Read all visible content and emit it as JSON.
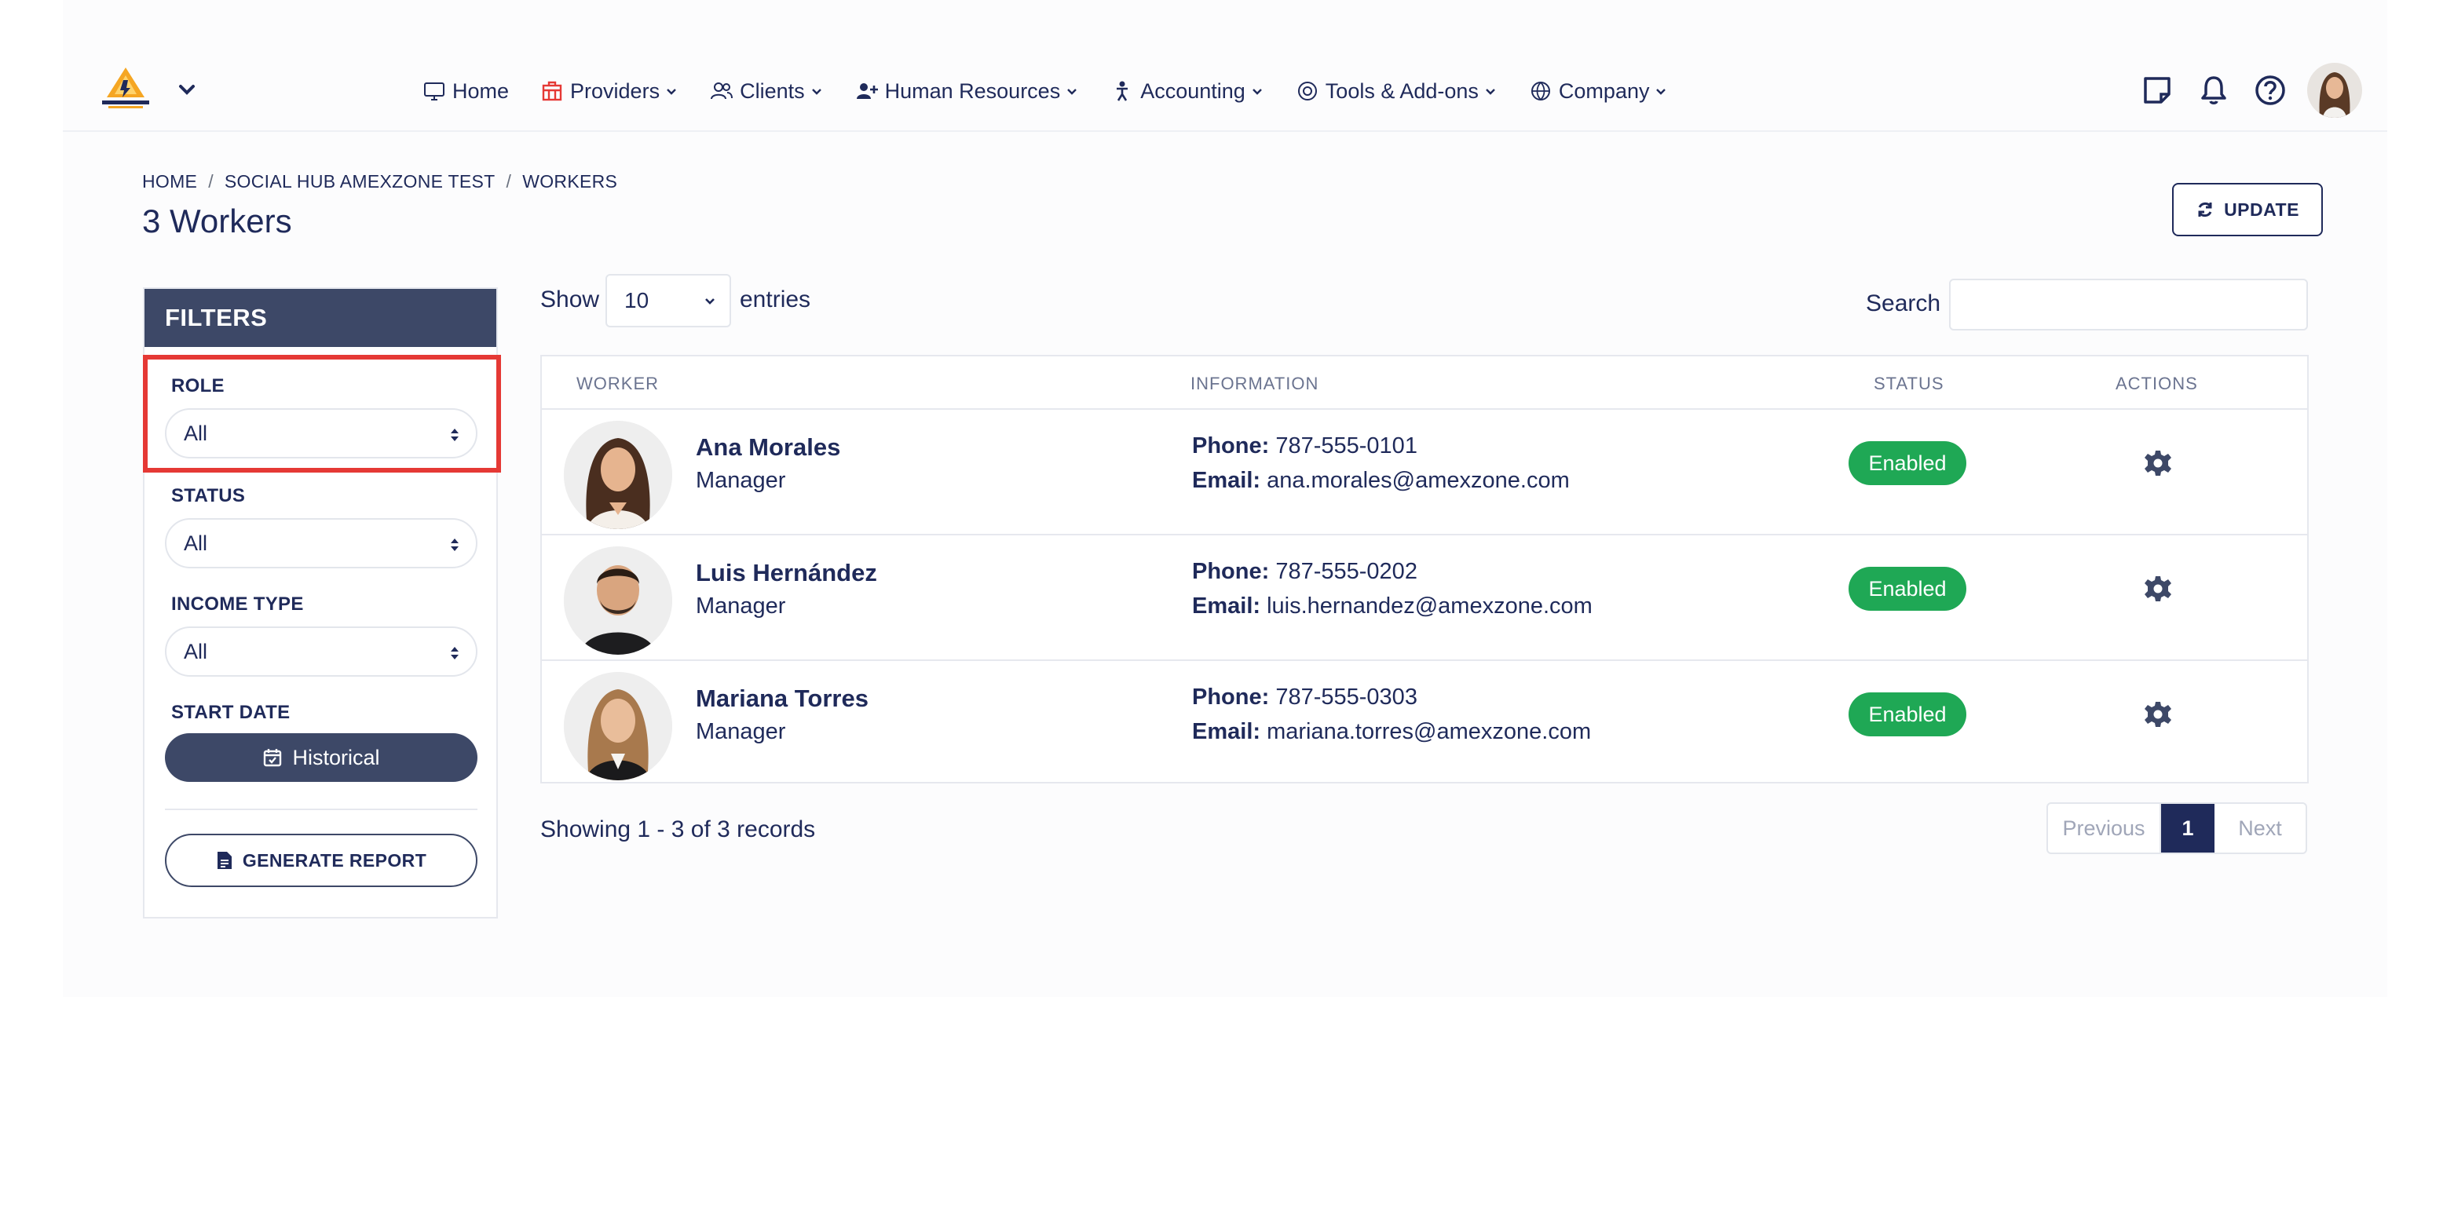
{
  "nav": {
    "items": [
      {
        "label": "Home",
        "icon": "monitor-icon",
        "caret": false
      },
      {
        "label": "Providers",
        "icon": "building-icon",
        "caret": true
      },
      {
        "label": "Clients",
        "icon": "users-icon",
        "caret": true
      },
      {
        "label": "Human Resources",
        "icon": "user-plus-icon",
        "caret": true
      },
      {
        "label": "Accounting",
        "icon": "figure-icon",
        "caret": true
      },
      {
        "label": "Tools & Add-ons",
        "icon": "target-icon",
        "caret": true
      },
      {
        "label": "Company",
        "icon": "globe-icon",
        "caret": true
      }
    ],
    "right_icons": [
      "notes-icon",
      "bell-icon",
      "help-icon"
    ]
  },
  "colors": {
    "primary": "#1f2a5a",
    "panel": "#3d4867",
    "enabled": "#1fa855",
    "highlight": "#e53935",
    "providers_icon": "#e53935"
  },
  "breadcrumb": [
    "HOME",
    "SOCIAL HUB AMEXZONE TEST",
    "WORKERS"
  ],
  "page_title": "3 Workers",
  "update_label": "UPDATE",
  "filters": {
    "title": "FILTERS",
    "role": {
      "label": "ROLE",
      "value": "All"
    },
    "status": {
      "label": "STATUS",
      "value": "All"
    },
    "income_type": {
      "label": "INCOME TYPE",
      "value": "All"
    },
    "start_date": {
      "label": "START DATE",
      "button": "Historical"
    },
    "report_label": "GENERATE REPORT"
  },
  "table_controls": {
    "show": "Show",
    "entries_value": "10",
    "entries": "entries",
    "search": "Search",
    "search_value": ""
  },
  "table": {
    "headers": [
      "WORKER",
      "INFORMATION",
      "STATUS",
      "ACTIONS"
    ],
    "phone_label": "Phone:",
    "email_label": "Email:",
    "rows": [
      {
        "name": "Ana Morales",
        "role": "Manager",
        "phone": "787-555-0101",
        "email": "ana.morales@amexzone.com",
        "status": "Enabled"
      },
      {
        "name": "Luis Hernández",
        "role": "Manager",
        "phone": "787-555-0202",
        "email": "luis.hernandez@amexzone.com",
        "status": "Enabled"
      },
      {
        "name": "Mariana Torres",
        "role": "Manager",
        "phone": "787-555-0303",
        "email": "mariana.torres@amexzone.com",
        "status": "Enabled"
      }
    ]
  },
  "footer": {
    "showing": "Showing 1 - 3 of 3 records",
    "previous": "Previous",
    "current_page": "1",
    "next": "Next"
  }
}
